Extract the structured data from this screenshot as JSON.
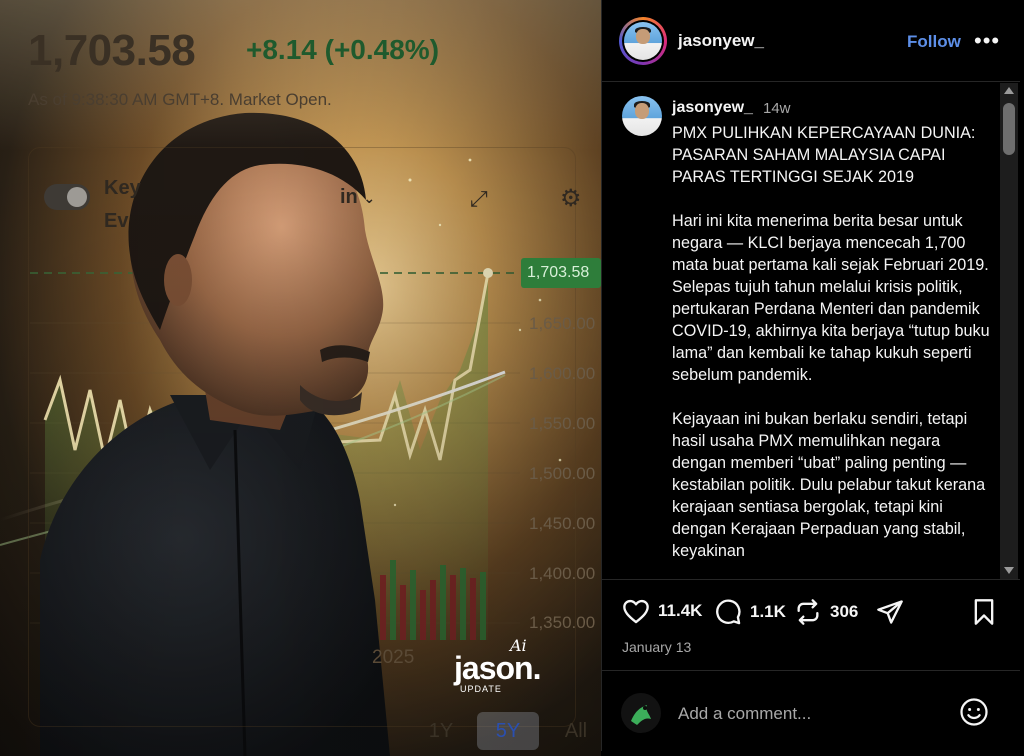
{
  "media": {
    "price": "1,703.58",
    "change": "+8.14 (+0.48%)",
    "as_of": "As of 9:38:30 AM GMT+8. Market Open.",
    "toggle_label_line1": "Key",
    "toggle_label_line2": "Ev",
    "timespan_label": "in",
    "axis_labels": [
      "1,650.00",
      "1,600.00",
      "1,550.00",
      "1,500.00",
      "1,450.00",
      "1,400.00",
      "1,350.00"
    ],
    "last_price_tag": "1,703.58",
    "year_label": "2025",
    "range_buttons": [
      "1Y",
      "5Y",
      "All"
    ],
    "active_range": "5Y",
    "logo_ai": "Ai",
    "logo_name": "jason.",
    "logo_sub": "UPDATE"
  },
  "header": {
    "username": "jasonyew_",
    "follow_label": "Follow",
    "more_label": "•••"
  },
  "caption": {
    "username": "jasonyew_",
    "time": "14w",
    "text": "PMX PULIHKAN KEPERCAYAAN DUNIA: PASARAN SAHAM MALAYSIA CAPAI PARAS TERTINGGI SEJAK 2019\n\nHari ini kita menerima berita besar untuk negara — KLCI berjaya mencecah 1,700 mata buat pertama kali sejak Februari 2019. Selepas tujuh tahun melalui krisis politik, pertukaran Perdana Menteri dan pandemik COVID-19, akhirnya kita berjaya “tutup buku lama” dan kembali ke tahap kukuh seperti sebelum pandemik.\n\nKejayaan ini bukan berlaku sendiri, tetapi hasil usaha PMX memulihkan negara dengan memberi “ubat” paling penting — kestabilan politik. Dulu pelabur takut kerana kerajaan sentiasa bergolak, tetapi kini dengan Kerajaan Perpaduan yang stabil, keyakinan"
  },
  "actions": {
    "likes": "11.4K",
    "comments": "1.1K",
    "reposts": "306"
  },
  "post_date": "January 13",
  "comment_box": {
    "placeholder": "Add a comment..."
  }
}
